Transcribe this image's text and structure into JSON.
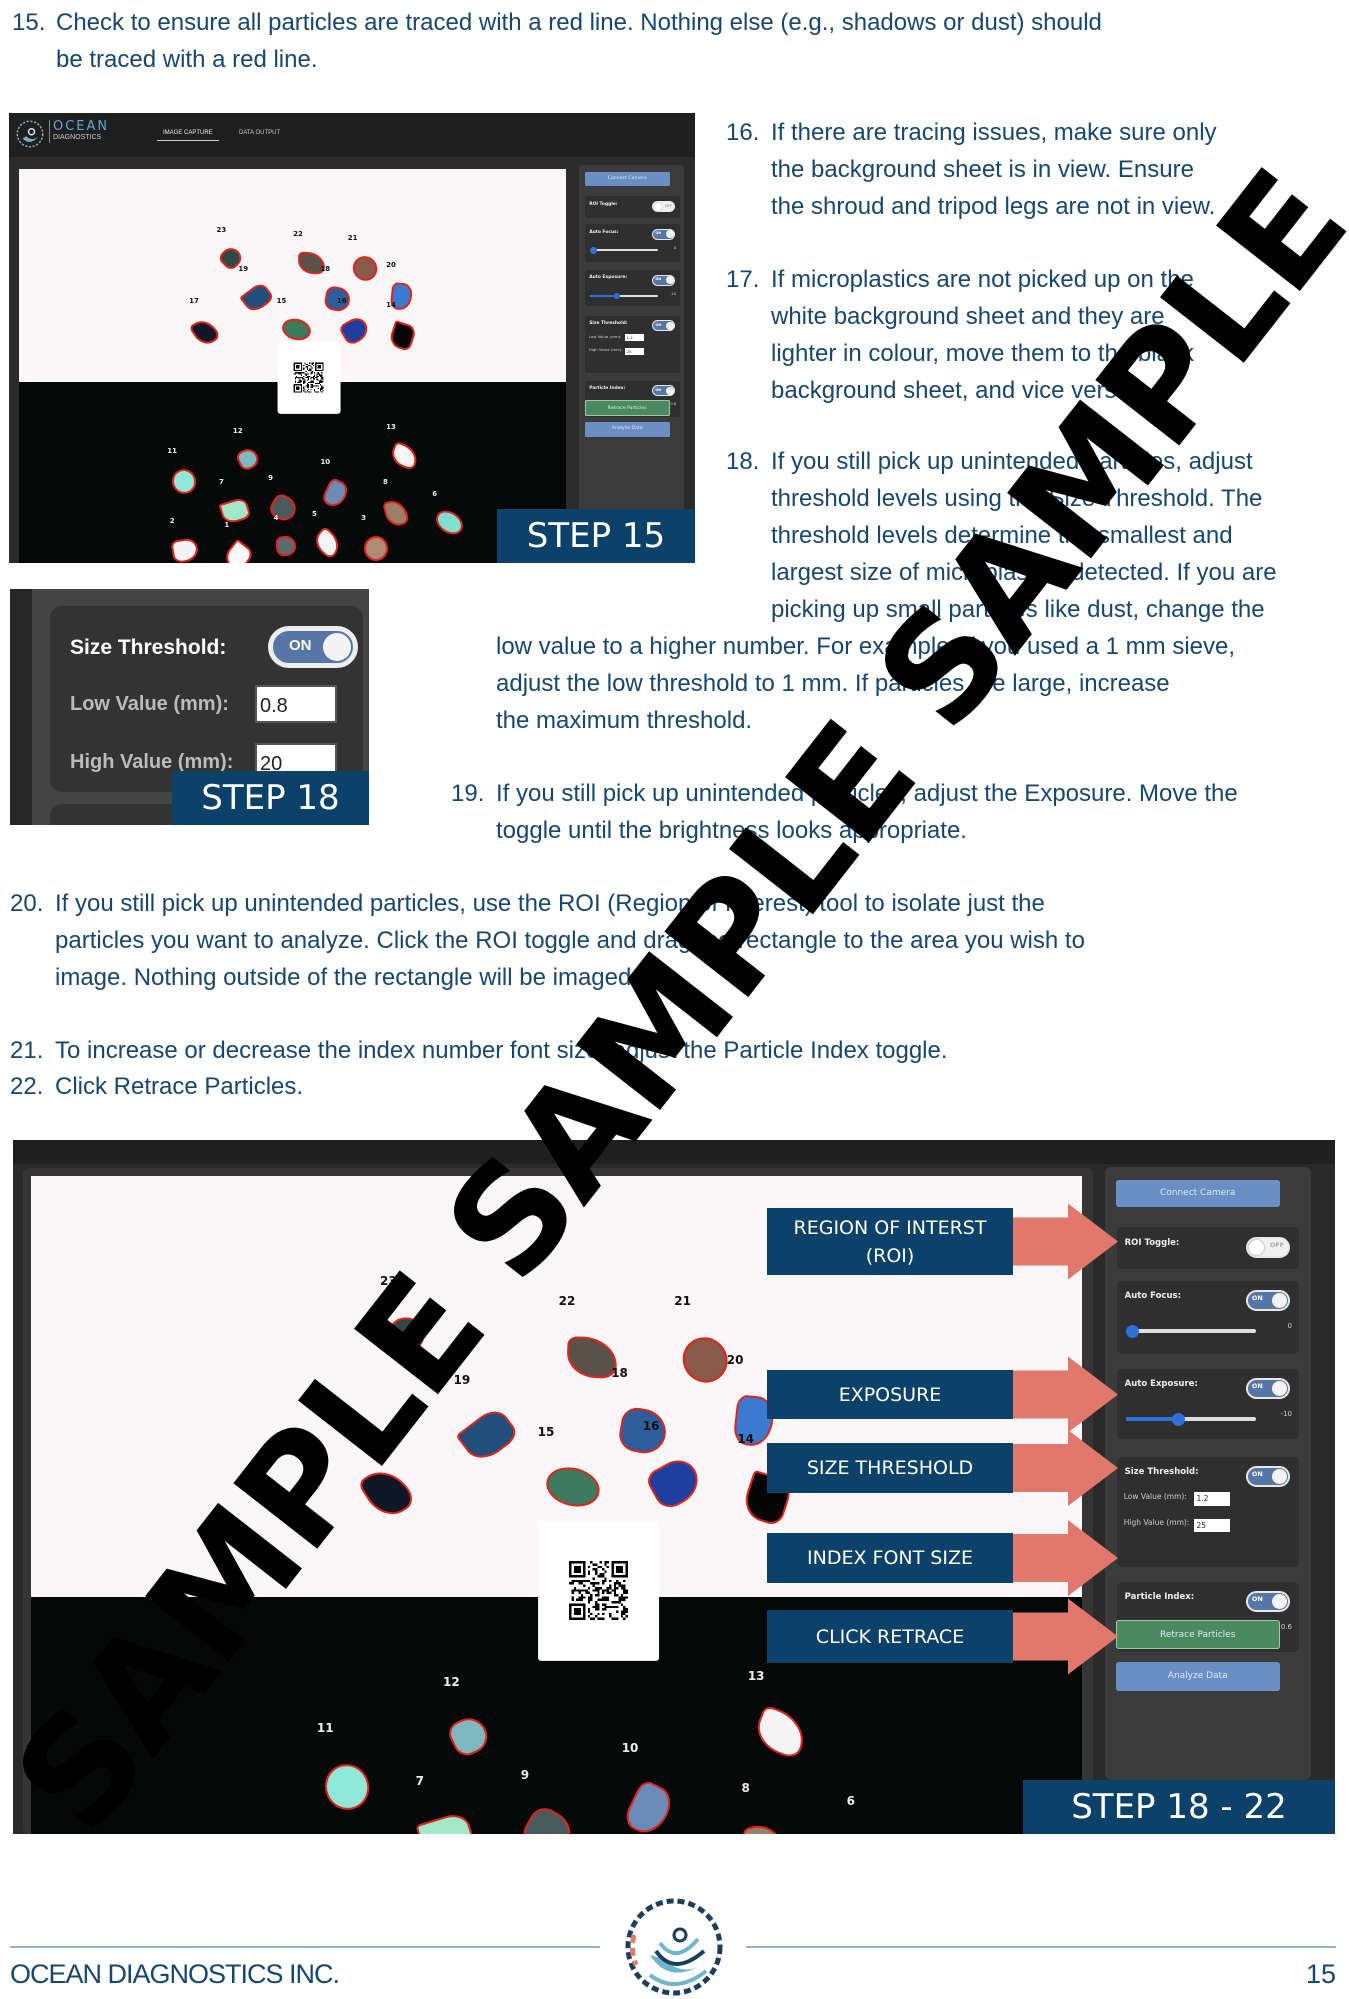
{
  "colors": {
    "text": "#17466f",
    "step_bg": "#0c4269",
    "arrow": "#e2776c",
    "trace": "#e0241c"
  },
  "items": [
    {
      "num": "15.",
      "lines": [
        "Check to ensure all particles are traced with a red line. Nothing else (e.g., shadows or dust) should",
        "be traced with a red line."
      ]
    },
    {
      "num": "16.",
      "lines": [
        "If there are tracing issues, make sure only",
        "the background sheet is in view. Ensure",
        "the shroud and tripod legs are not in view."
      ]
    },
    {
      "num": "17.",
      "lines": [
        "If microplastics are not picked up on the",
        "white background sheet and they are",
        "lighter in colour, move them to the black",
        "background sheet, and vice versa."
      ]
    },
    {
      "num": "18.",
      "lines": [
        "If you still pick up unintended particles, adjust",
        "threshold levels using the Size Threshold. The",
        "threshold levels determine the smallest and",
        "largest size of microplastics detected. If you are",
        "picking up small particles like dust, change the"
      ],
      "continuation": [
        "low value to a higher number. For example, if you used a 1 mm sieve,",
        "adjust the low threshold to 1 mm. If particles are large, increase",
        "the maximum threshold."
      ]
    },
    {
      "num": "19.",
      "lines": [
        "If you still pick up unintended particles, adjust the Exposure. Move the",
        "toggle until the brightness looks appropriate."
      ]
    },
    {
      "num": "20.",
      "lines": [
        "If you still pick up unintended particles, use the ROI (Region of Interest) tool to isolate just the",
        "particles you want to analyze. Click the ROI toggle and drag the rectangle to the area you wish to",
        "image. Nothing outside of the rectangle will be imaged."
      ]
    },
    {
      "num": "21.",
      "lines": [
        "To increase or decrease the index number font size, adjust the Particle Index toggle."
      ]
    },
    {
      "num": "22.",
      "lines": [
        "Click Retrace Particles."
      ]
    }
  ],
  "app": {
    "brand_line1": "OCEAN",
    "brand_line2": "DIAGNOSTICS",
    "tabs": [
      "IMAGE CAPTURE",
      "DATA OUTPUT"
    ]
  },
  "panel": {
    "connect": "Connect Camera",
    "roi_label": "ROI Toggle:",
    "roi_state": "OFF",
    "af_label": "Auto Focus:",
    "af_state": "ON",
    "af_value": "0",
    "af_level": 0.05,
    "ae_label": "Auto Exposure:",
    "ae_state": "ON",
    "ae_value": "-10",
    "ae_level": 0.4,
    "st_label": "Size Threshold:",
    "st_state": "ON",
    "low_label": "Low Value (mm):",
    "low_value": "1.2",
    "high_label": "High Value (mm):",
    "high_value": "25",
    "pi_label": "Particle Index:",
    "pi_state": "ON",
    "pi_value": "0.6",
    "pi_level": 0.35,
    "retrace": "Retrace Particles",
    "analyze": "Analyze Data"
  },
  "particles": [
    {
      "id": "23",
      "color": "#2e4a44"
    },
    {
      "id": "22",
      "color": "#5a5248"
    },
    {
      "id": "21",
      "color": "#8a5a4a"
    },
    {
      "id": "20",
      "color": "#3a7ad0"
    },
    {
      "id": "19",
      "color": "#1f4f7a"
    },
    {
      "id": "18",
      "color": "#2d5d9a"
    },
    {
      "id": "17",
      "color": "#101828"
    },
    {
      "id": "15",
      "color": "#3d7a5e"
    },
    {
      "id": "16",
      "color": "#1e3fa0"
    },
    {
      "id": "14",
      "color": "#050505"
    },
    {
      "id": "12",
      "color": "#7fb8c0"
    },
    {
      "id": "13",
      "color": "#f5f5f5"
    },
    {
      "id": "11",
      "color": "#8fe8d8"
    },
    {
      "id": "10",
      "color": "#6a8ab8"
    },
    {
      "id": "7",
      "color": "#a0e8c8"
    },
    {
      "id": "9",
      "color": "#4a5a5a"
    },
    {
      "id": "8",
      "color": "#9a8068"
    },
    {
      "id": "6",
      "color": "#80e0d0"
    },
    {
      "id": "2",
      "color": "#f4f4f4"
    },
    {
      "id": "1",
      "color": "#f8f8f8"
    },
    {
      "id": "4",
      "color": "#5a6a70"
    },
    {
      "id": "5",
      "color": "#f6f6f6"
    },
    {
      "id": "3",
      "color": "#b08a78"
    }
  ],
  "step18_zoom": {
    "st_label": "Size Threshold:",
    "st_state": "ON",
    "low_label": "Low Value (mm):",
    "low_value": "0.8",
    "high_label": "High Value (mm):",
    "high_value": "20"
  },
  "steps": {
    "s15": "STEP 15",
    "s18": "STEP 18",
    "s18_22": "STEP 18 - 22"
  },
  "callouts": [
    "REGION OF INTERST (ROI)",
    "EXPOSURE",
    "SIZE THRESHOLD",
    "INDEX FONT SIZE",
    "CLICK RETRACE"
  ],
  "footer": {
    "company": "OCEAN DIAGNOSTICS INC.",
    "page": "15"
  },
  "watermark": "SAMPLE SAMPLE SAMPLE"
}
